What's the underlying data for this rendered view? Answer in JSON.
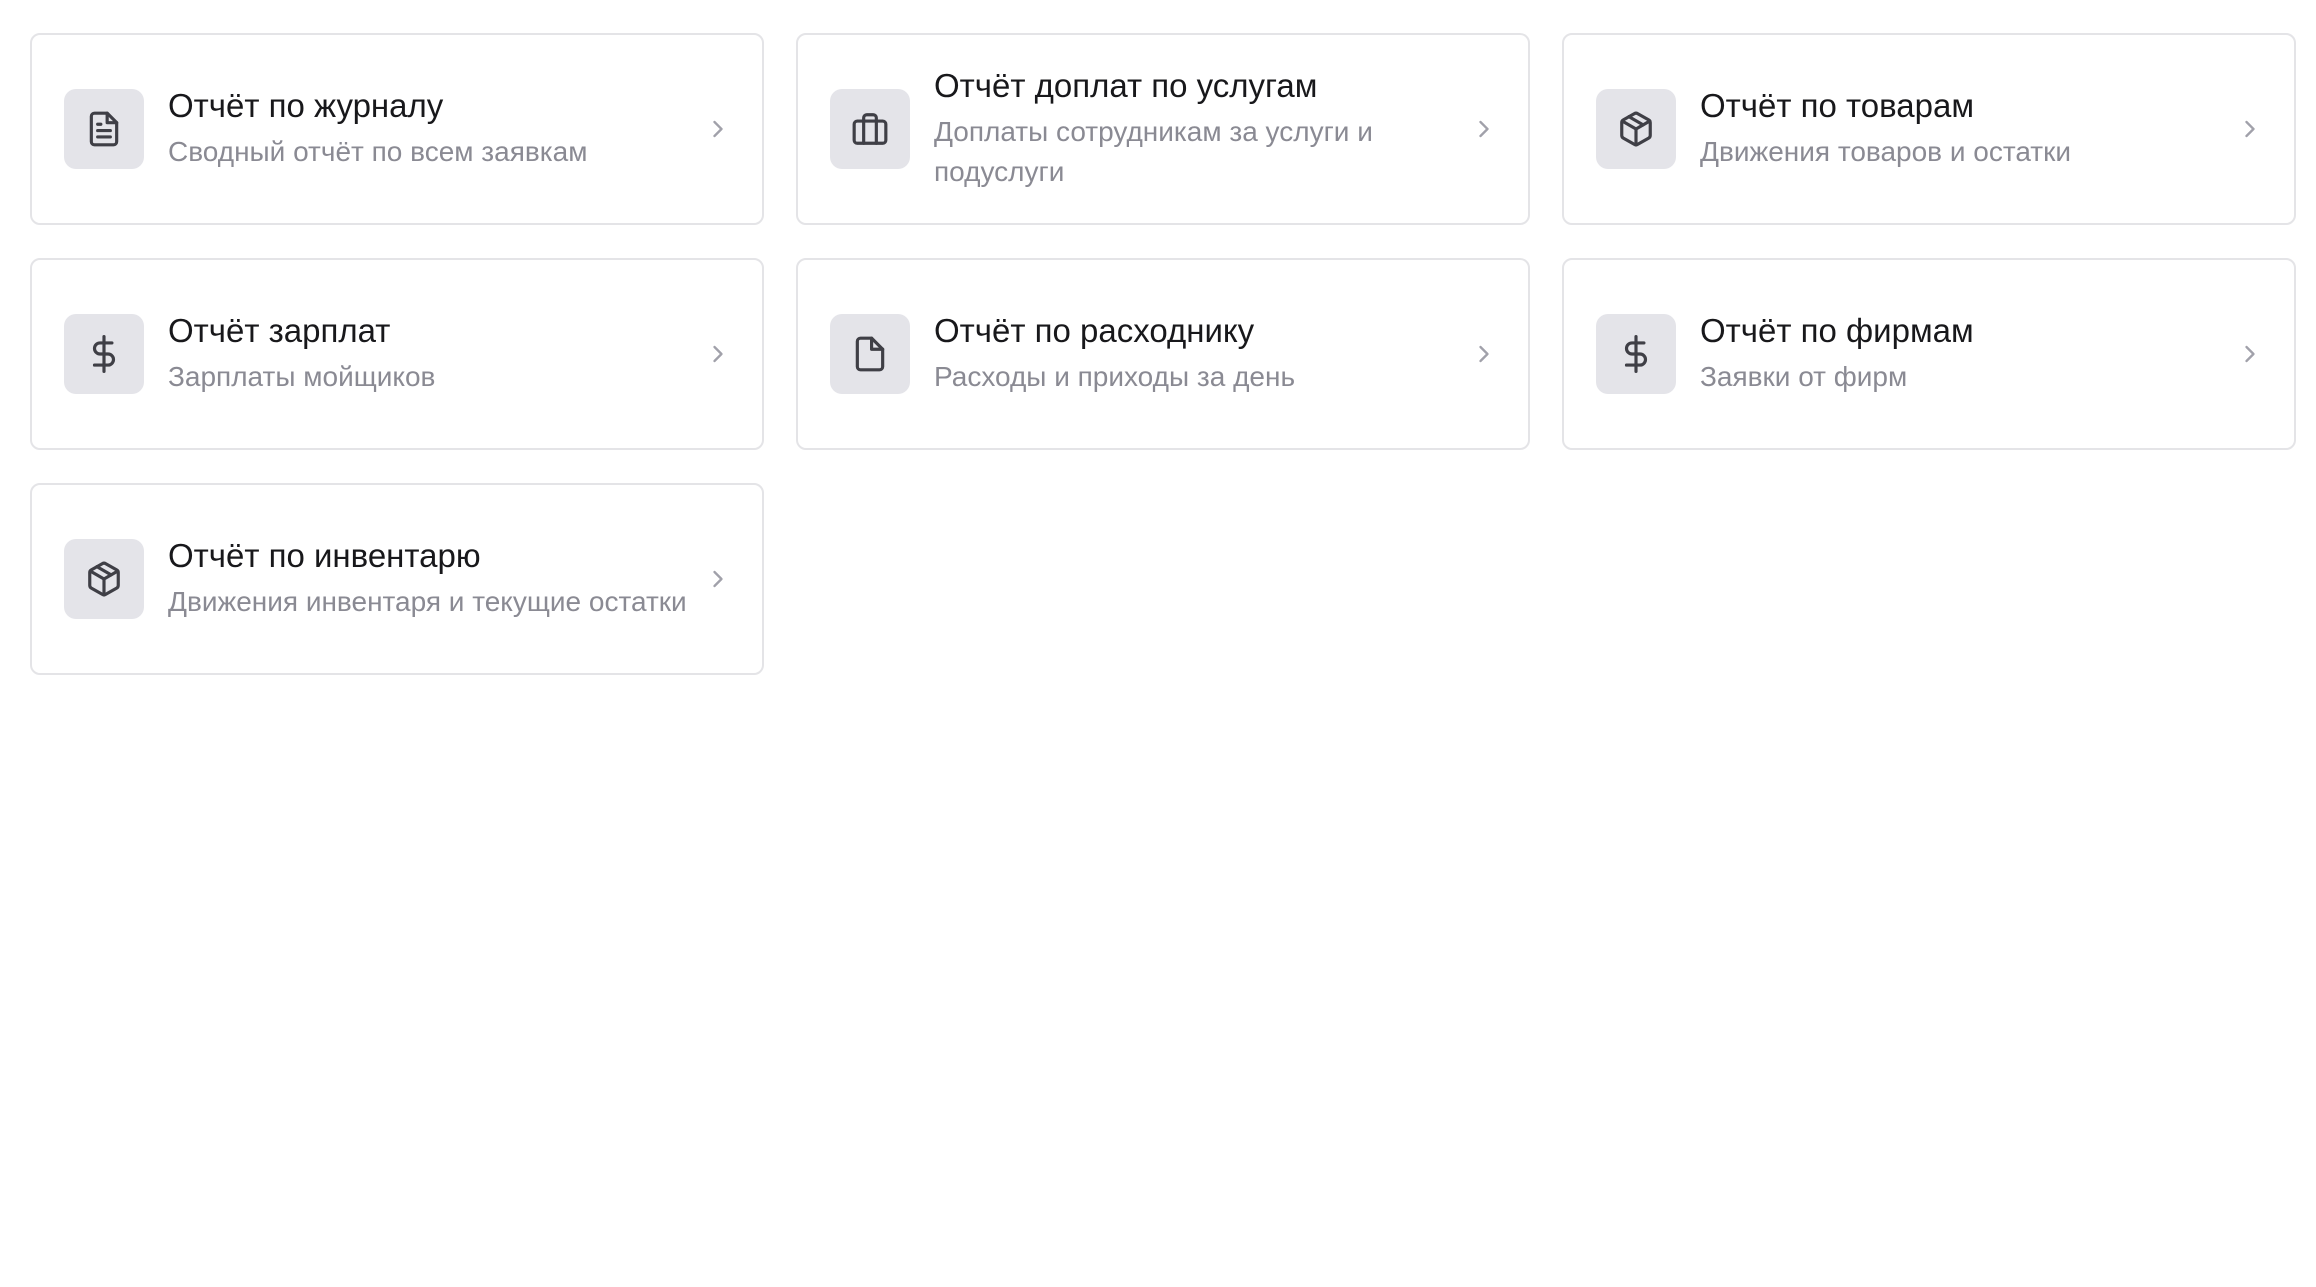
{
  "reports": [
    {
      "title": "Отчёт по журналу",
      "subtitle": "Сводный отчёт по всем заявкам",
      "icon": "file-text-icon"
    },
    {
      "title": "Отчёт доплат по услугам",
      "subtitle": "Доплаты сотрудникам за услуги и подуслуги",
      "icon": "briefcase-icon"
    },
    {
      "title": "Отчёт по товарам",
      "subtitle": "Движения товаров и остатки",
      "icon": "package-icon"
    },
    {
      "title": "Отчёт зарплат",
      "subtitle": "Зарплаты мойщиков",
      "icon": "dollar-icon"
    },
    {
      "title": "Отчёт по расходнику",
      "subtitle": "Расходы и приходы за день",
      "icon": "file-icon"
    },
    {
      "title": "Отчёт по фирмам",
      "subtitle": "Заявки от фирм",
      "icon": "dollar-icon"
    },
    {
      "title": "Отчёт по инвентарю",
      "subtitle": "Движения инвентаря и текущие остатки",
      "icon": "package-icon"
    }
  ],
  "colors": {
    "card_border": "#e4e4e7",
    "icon_bg": "#e4e4e9",
    "title": "#18181b",
    "subtitle": "#8a8a93",
    "chevron": "#a1a1aa"
  }
}
